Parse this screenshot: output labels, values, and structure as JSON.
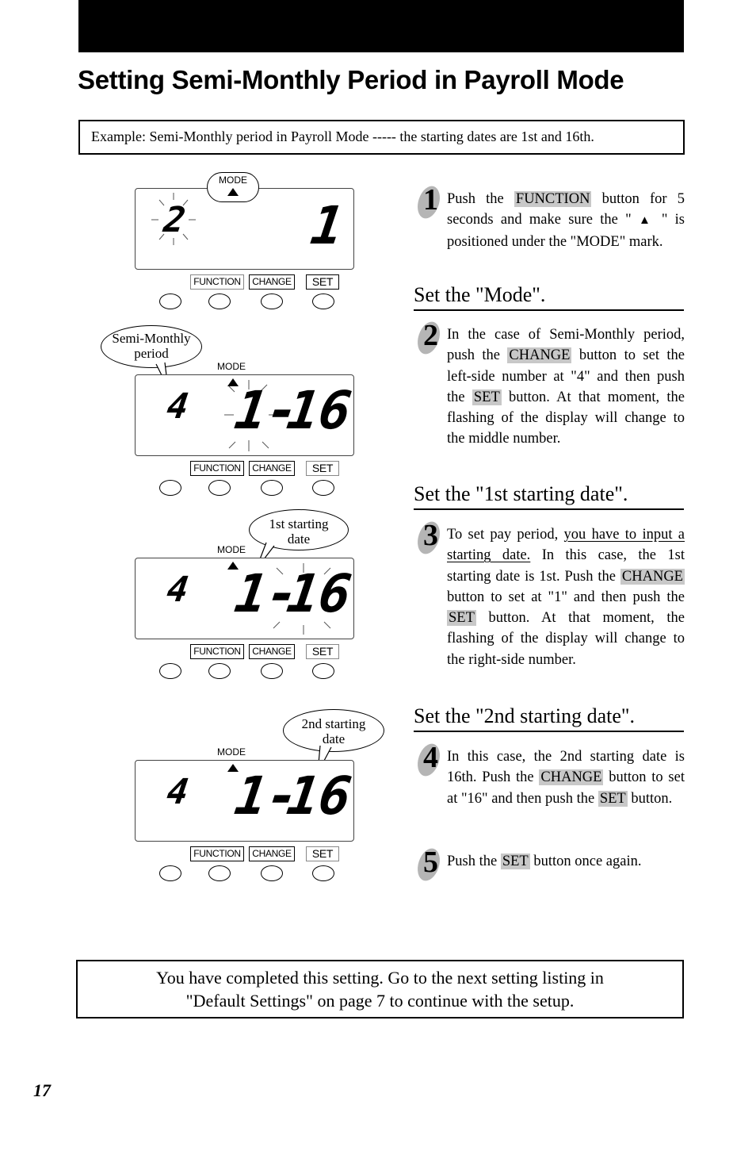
{
  "page": {
    "title": "Setting Semi-Monthly Period in Payroll Mode",
    "example": "Example:  Semi-Monthly period in Payroll Mode ----- the starting dates are 1st and 16th.",
    "page_number": "17",
    "footer": {
      "line1": "You have completed this setting.  Go to the next setting listing in",
      "line2": "\"Default Settings\" on page 7 to continue with the setup."
    }
  },
  "device": {
    "mode_label": "MODE",
    "buttons": {
      "function": "FUNCTION",
      "change": "CHANGE",
      "set": "SET"
    }
  },
  "panels": [
    {
      "left_digit": "2",
      "middle": "",
      "right": "1",
      "flashing": "left",
      "callout": "",
      "highlighted_button": "FUNCTION"
    },
    {
      "left_digit": "4",
      "middle": "1-",
      "right": "16",
      "flashing": "middle",
      "callout": "Semi-Monthly period",
      "callout_line1": "Semi-Monthly",
      "callout_line2": "period",
      "highlighted_button": "SET"
    },
    {
      "left_digit": "4",
      "middle": "1-",
      "right": "16",
      "flashing": "right",
      "callout": "1st starting date",
      "callout_line1": "1st starting",
      "callout_line2": "date",
      "highlighted_button": "SET"
    },
    {
      "left_digit": "4",
      "middle": "1-",
      "right": "16",
      "flashing": "none",
      "callout": "2nd starting date",
      "callout_line1": "2nd starting",
      "callout_line2": "date",
      "highlighted_button": "SET"
    }
  ],
  "sections": {
    "mode": "Set the \"Mode\".",
    "first_date": "Set the \"1st starting date\".",
    "second_date": "Set the \"2nd starting date\"."
  },
  "steps": [
    {
      "number": "1",
      "parts": [
        "Push the ",
        "FUNCTION",
        " button for 5 seconds and make sure the \" ",
        "▲",
        " \" is positioned under the \"MODE\" mark."
      ]
    },
    {
      "number": "2",
      "parts": [
        "In the case of Semi-Monthly period, push the ",
        "CHANGE",
        " button to set the left-side number at \"4\" and then push the ",
        "SET",
        " button. At that moment, the flashing of the display will change to the middle number."
      ]
    },
    {
      "number": "3",
      "parts": [
        "To set pay period, ",
        "you have to input a starting date.",
        " In this case, the 1st starting date is 1st. Push the ",
        "CHANGE",
        " button to set at \"1\" and then push the ",
        "SET",
        " button. At that moment, the flashing of the display will change to the right-side number."
      ]
    },
    {
      "number": "4",
      "parts": [
        "In this case, the 2nd starting date is 16th. Push the ",
        "CHANGE",
        " button to set at \"16\" and then push the ",
        "SET",
        " button."
      ]
    },
    {
      "number": "5",
      "parts": [
        "Push the ",
        "SET",
        " button once again."
      ]
    }
  ]
}
